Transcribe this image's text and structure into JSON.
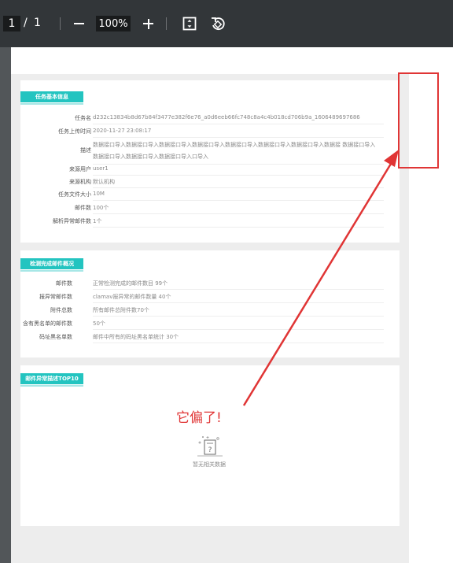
{
  "toolbar": {
    "page_current": "1",
    "page_sep": "/",
    "page_total": "1",
    "zoom": "100%"
  },
  "card_basic": {
    "title": "任务基本信息",
    "rows": [
      {
        "label": "任务名",
        "value": "d232c13834b8d67b84f3477e382f6e76_a0d6eeb66fc748c8a4c4b018cd706b9a_1606489697686"
      },
      {
        "label": "任务上传时间",
        "value": "2020-11-27 23:08:17"
      },
      {
        "label": "描述",
        "value": "数据接口导入数据接口导入数据接口导入数据接口导入数据接口导入数据接口导入数据接口导入数据接 数据接口导入",
        "value2": "数据接口导入数据接口导入数据接口导入口导入"
      },
      {
        "label": "来源用户",
        "value": "user1"
      },
      {
        "label": "来源机构",
        "value": "默认机构"
      },
      {
        "label": "任务文件大小",
        "value": "10M"
      },
      {
        "label": "邮件数",
        "value": "100个"
      },
      {
        "label": "解析异常邮件数",
        "value": "1个"
      }
    ]
  },
  "card_check": {
    "title": "检测完成邮件概况",
    "rows": [
      {
        "label": "邮件数",
        "value": "正常检测完成的邮件数目 99个"
      },
      {
        "label": "报异常邮件数",
        "value": "clamav报异常的邮件数量 40个"
      },
      {
        "label": "附件总数",
        "value": "所有邮件总附件数70个"
      },
      {
        "label": "含有黑名单的邮件数",
        "value": "50个"
      },
      {
        "label": "码址黑名单数",
        "value": "邮件中所有的码址黑名单统计 30个"
      }
    ]
  },
  "card_top": {
    "title": "邮件异常描述TOP10",
    "empty_text": "暂无相关数据"
  },
  "annotation": {
    "text": "它偏了!",
    "color": "#e03535"
  },
  "colors": {
    "accent": "#23c4c0",
    "toolbar": "#323639",
    "annotation": "#e03535"
  }
}
